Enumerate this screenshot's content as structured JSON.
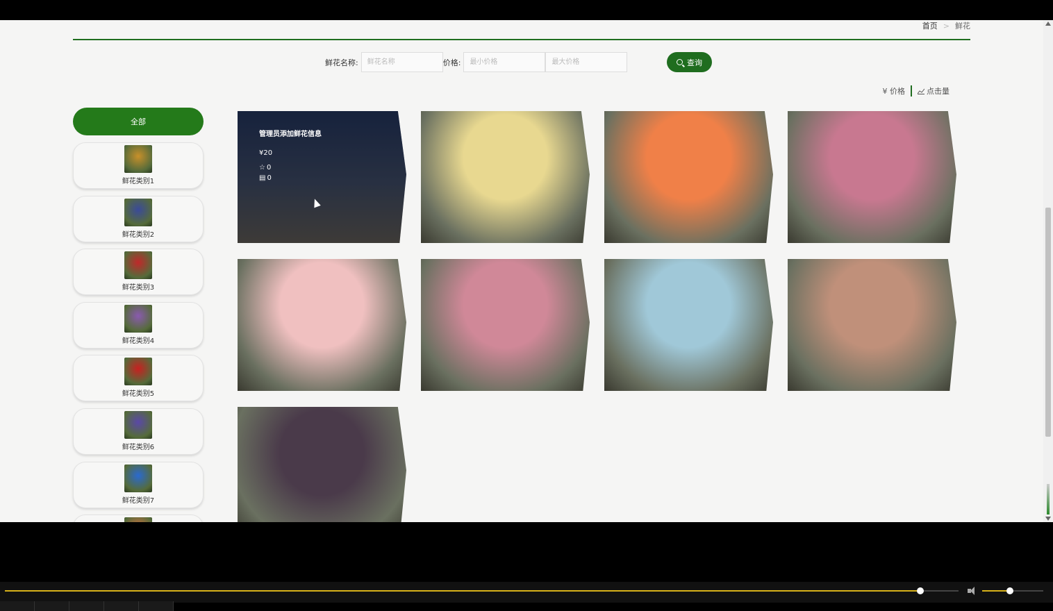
{
  "breadcrumb": {
    "home": "首页",
    "sep": ">",
    "current": "鲜花"
  },
  "search": {
    "name_label": "鲜花名称:",
    "name_placeholder": "鲜花名称",
    "price_label": "价格:",
    "min_placeholder": "最小价格",
    "max_placeholder": "最大价格",
    "query_label": "查询"
  },
  "sort": {
    "price": "¥ 价格",
    "clicks": "点击量"
  },
  "sidebar": {
    "all_label": "全部",
    "categories": [
      {
        "label": "鲜花类别1",
        "color": "#c8902a"
      },
      {
        "label": "鲜花类别2",
        "color": "#3a4a9a"
      },
      {
        "label": "鲜花类别3",
        "color": "#c0282a"
      },
      {
        "label": "鲜花类别4",
        "color": "#8a5ab0"
      },
      {
        "label": "鲜花类别5",
        "color": "#c82020"
      },
      {
        "label": "鲜花类别6",
        "color": "#5a48a8"
      },
      {
        "label": "鲜花类别7",
        "color": "#2a6ad0"
      },
      {
        "label": "",
        "color": "#d07040"
      }
    ]
  },
  "products": [
    {
      "name": "管理员添加鲜花信息",
      "price": "¥20",
      "favorites": "0",
      "comments": "0",
      "bg": "#2a3348",
      "hover": true
    },
    {
      "bg": "#e8d890"
    },
    {
      "bg": "#f08048"
    },
    {
      "bg": "#c87890"
    },
    {
      "bg": "#f0c0c0"
    },
    {
      "bg": "#d08898"
    },
    {
      "bg": "#a0c8d8"
    },
    {
      "bg": "#c0907a"
    },
    {
      "bg": "#4a3a4a"
    }
  ],
  "player": {
    "progress": 0.96,
    "volume": 0.45
  }
}
